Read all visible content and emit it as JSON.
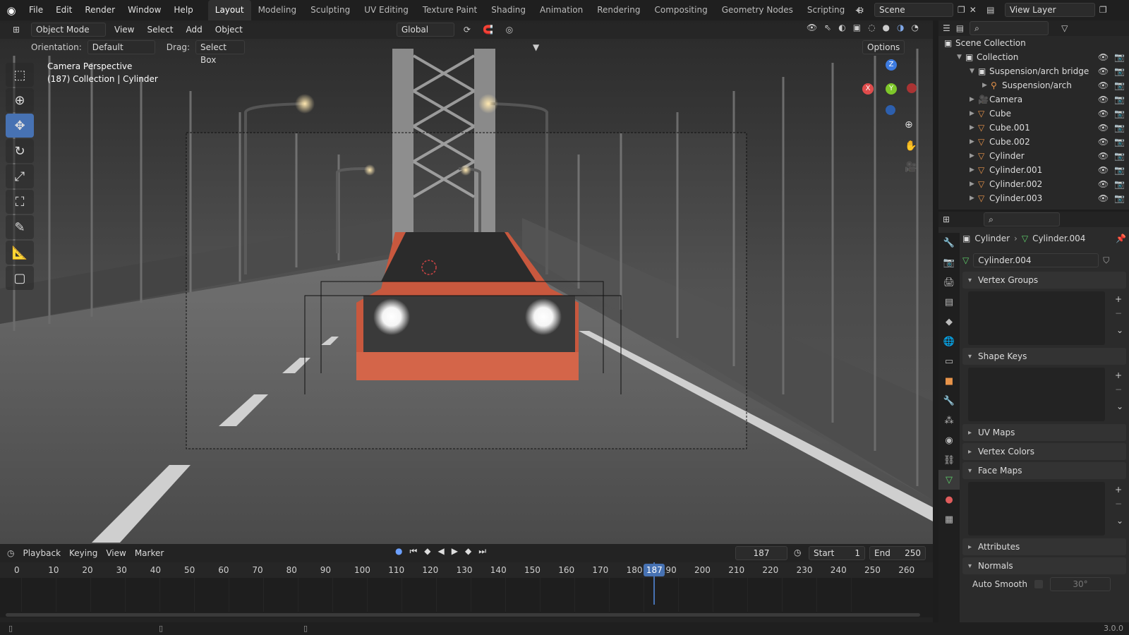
{
  "menu": {
    "items": [
      "File",
      "Edit",
      "Render",
      "Window",
      "Help"
    ],
    "workspaces": [
      "Layout",
      "Modeling",
      "Sculpting",
      "UV Editing",
      "Texture Paint",
      "Shading",
      "Animation",
      "Rendering",
      "Compositing",
      "Geometry Nodes",
      "Scripting"
    ],
    "active_workspace": "Layout",
    "scene_name": "Scene",
    "view_layer": "View Layer"
  },
  "viewport": {
    "mode": "Object Mode",
    "menus": [
      "View",
      "Select",
      "Add",
      "Object"
    ],
    "transform": "Global",
    "orientation_label": "Orientation:",
    "orientation_value": "Default",
    "drag_label": "Drag:",
    "drag_value": "Select Box",
    "options_label": "Options",
    "overlay_line1": "Camera Perspective",
    "overlay_line2": "(187) Collection | Cylinder",
    "gizmo": {
      "x": "X",
      "y": "Y",
      "z": "Z"
    }
  },
  "outliner": {
    "root": "Scene Collection",
    "items": [
      {
        "label": "Collection",
        "icon": "collection-icon",
        "level": 1,
        "expanded": true
      },
      {
        "label": "Suspension/arch bridge",
        "icon": "collection-icon",
        "level": 2,
        "expanded": true
      },
      {
        "label": "Suspension/arch",
        "icon": "armature-icon",
        "level": 3,
        "expanded": false
      },
      {
        "label": "Camera",
        "icon": "camera-icon",
        "level": 2,
        "expanded": false
      },
      {
        "label": "Cube",
        "icon": "mesh-icon",
        "level": 2,
        "expanded": false
      },
      {
        "label": "Cube.001",
        "icon": "mesh-icon",
        "level": 2,
        "expanded": false
      },
      {
        "label": "Cube.002",
        "icon": "mesh-icon",
        "level": 2,
        "expanded": false
      },
      {
        "label": "Cylinder",
        "icon": "mesh-icon",
        "level": 2,
        "expanded": false
      },
      {
        "label": "Cylinder.001",
        "icon": "mesh-icon",
        "level": 2,
        "expanded": false
      },
      {
        "label": "Cylinder.002",
        "icon": "mesh-icon",
        "level": 2,
        "expanded": false
      },
      {
        "label": "Cylinder.003",
        "icon": "mesh-icon",
        "level": 2,
        "expanded": false
      }
    ]
  },
  "properties": {
    "breadcrumb_object": "Cylinder",
    "breadcrumb_data": "Cylinder.004",
    "mesh_name": "Cylinder.004",
    "panels": [
      {
        "label": "Vertex Groups",
        "expanded": true
      },
      {
        "label": "Shape Keys",
        "expanded": true
      },
      {
        "label": "UV Maps",
        "expanded": false
      },
      {
        "label": "Vertex Colors",
        "expanded": false
      },
      {
        "label": "Face Maps",
        "expanded": true
      },
      {
        "label": "Attributes",
        "expanded": false
      },
      {
        "label": "Normals",
        "expanded": true
      }
    ],
    "auto_smooth_label": "Auto Smooth",
    "auto_smooth_angle": "30°"
  },
  "timeline": {
    "menus": [
      "Playback",
      "Keying",
      "View",
      "Marker"
    ],
    "current_frame": "187",
    "start_label": "Start",
    "start_value": "1",
    "end_label": "End",
    "end_value": "250",
    "ruler_ticks": [
      "0",
      "10",
      "20",
      "30",
      "40",
      "50",
      "60",
      "70",
      "80",
      "90",
      "100",
      "110",
      "120",
      "130",
      "140",
      "150",
      "160",
      "170",
      "180",
      "190",
      "200",
      "210",
      "220",
      "230",
      "240",
      "250",
      "260"
    ],
    "playhead_label": "187"
  },
  "status": {
    "version": "3.0.0"
  }
}
